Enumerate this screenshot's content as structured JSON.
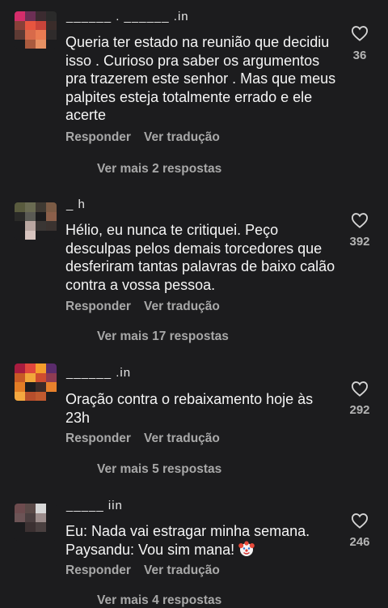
{
  "comments": [
    {
      "username": "______ . ______ .in",
      "text": "Queria ter estado na reunião que decidiu isso . Curioso pra saber os argumentos pra trazerem este senhor . Mas que meus palpites esteja totalmente errado e ele acerte",
      "reply_label": "Responder",
      "translate_label": "Ver tradução",
      "more_replies": "Ver mais 2 respostas",
      "likes": "36"
    },
    {
      "username": "_ h",
      "text": "Hélio, eu nunca te critiquei. Peço desculpas pelos demais torcedores que desferiram tantas palavras de baixo calão contra a vossa pessoa.",
      "reply_label": "Responder",
      "translate_label": "Ver tradução",
      "more_replies": "Ver mais 17 respostas",
      "likes": "392"
    },
    {
      "username": "______ .in",
      "text": "Oração contra o rebaixamento hoje às 23h",
      "reply_label": "Responder",
      "translate_label": "Ver tradução",
      "more_replies": "Ver mais 5 respostas",
      "likes": "292"
    },
    {
      "username": "_____ iin",
      "text": "Eu: Nada vai estragar minha semana. Paysandu: Vou sim mana!",
      "reply_label": "Responder",
      "translate_label": "Ver tradução",
      "more_replies": "Ver mais 4 respostas",
      "likes": "246",
      "emoji": "clown-face-emoji"
    }
  ],
  "icons": {
    "like": "heart-outline-icon"
  },
  "colors": {
    "background": "#1c1c1e",
    "text": "#f5f5f5",
    "muted": "#a8a8a8"
  }
}
